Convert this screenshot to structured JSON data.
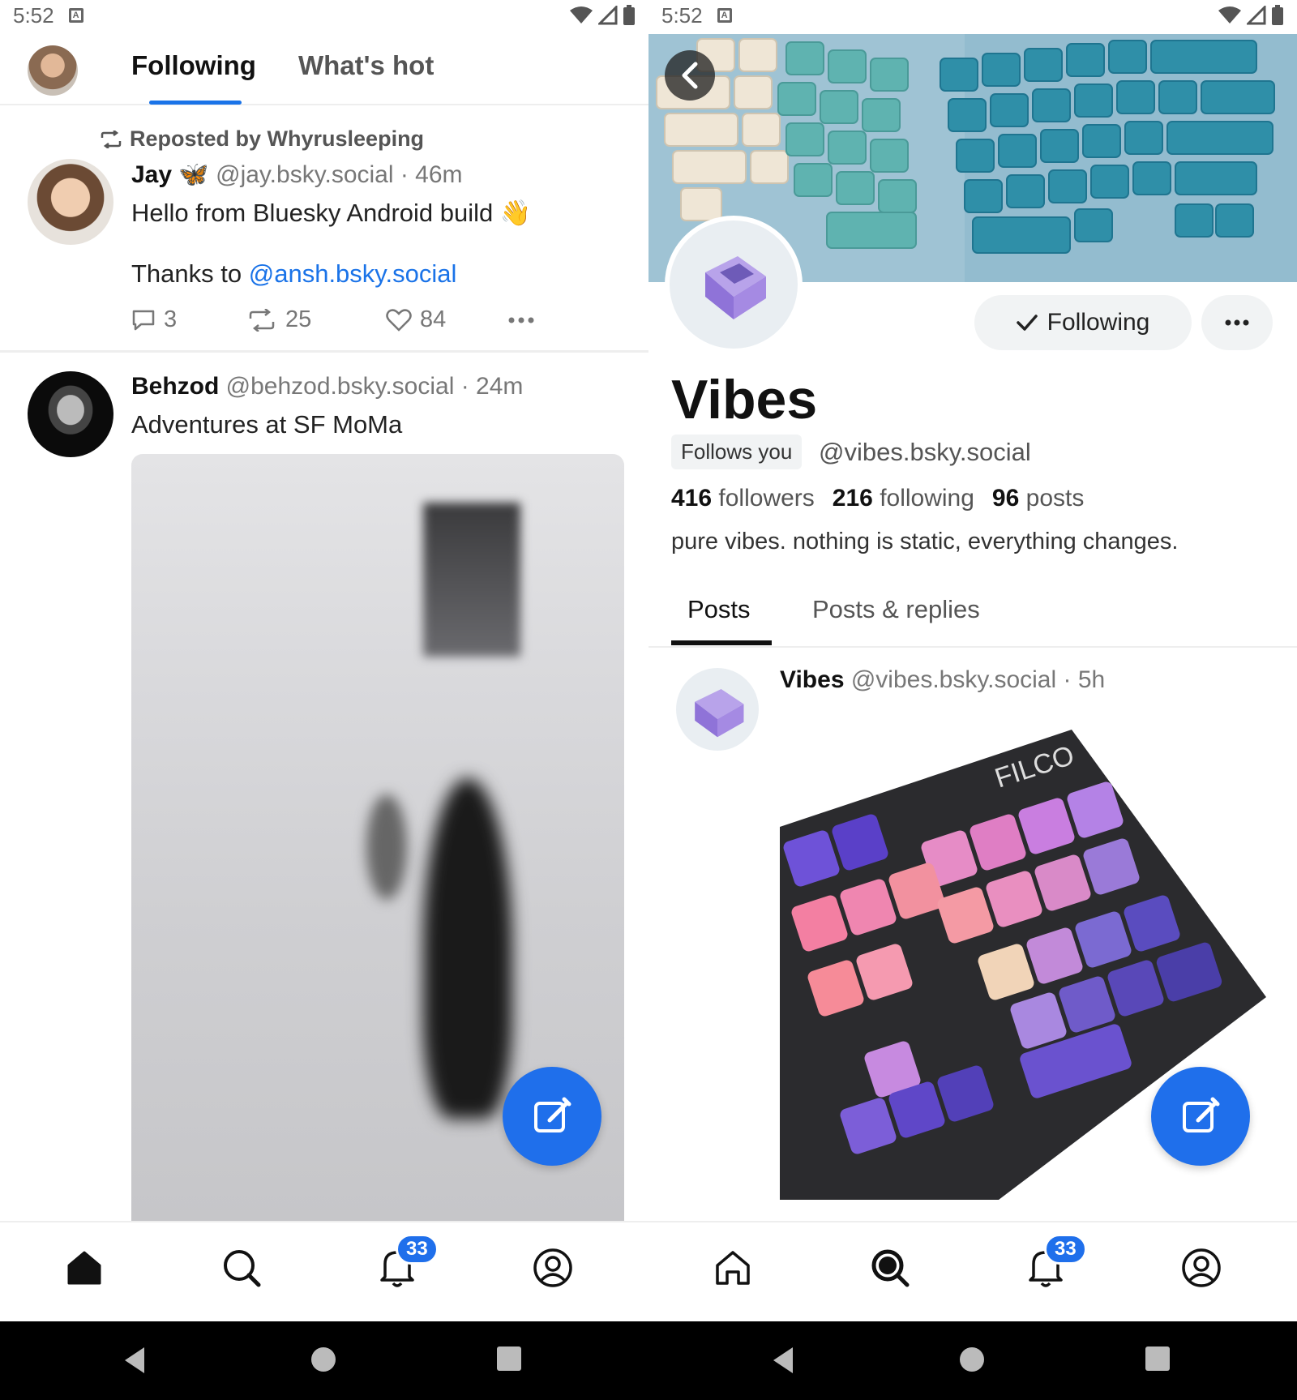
{
  "left": {
    "status": {
      "time": "5:52"
    },
    "tabs": [
      "Following",
      "What's hot"
    ],
    "feed": [
      {
        "repost_label": "Reposted by Whyrusleeping",
        "name": "Jay",
        "emoji": "🦋",
        "handle": "@jay.bsky.social",
        "time": "· 46m",
        "text_line1": "Hello from Bluesky Android build",
        "text_emoji": "👋",
        "text_line2_prefix": "Thanks to ",
        "text_mention": "@ansh.bsky.social",
        "replies": "3",
        "reposts": "25",
        "likes": "84"
      },
      {
        "name": "Behzod",
        "handle": "@behzod.bsky.social",
        "time": "· 24m",
        "text": "Adventures at SF MoMa"
      }
    ],
    "nav": {
      "notifications_badge": "33"
    }
  },
  "right": {
    "status": {
      "time": "5:52"
    },
    "profile": {
      "display_name": "Vibes",
      "follows_you": "Follows you",
      "handle": "@vibes.bsky.social",
      "followers_count": "416",
      "followers_label": "followers",
      "following_count": "216",
      "following_label": "following",
      "posts_count": "96",
      "posts_label": "posts",
      "bio": "pure vibes. nothing is static, everything changes.",
      "following_button": "Following"
    },
    "tabs": [
      "Posts",
      "Posts & replies"
    ],
    "post": {
      "name": "Vibes",
      "handle": "@vibes.bsky.social",
      "time": "· 5h",
      "image_text": "FILCO"
    },
    "nav": {
      "notifications_badge": "33"
    }
  },
  "colors": {
    "accent": "#1f6feb",
    "link": "#1a73e8"
  },
  "icons": [
    "repost-icon",
    "reply-icon",
    "like-icon",
    "more-icon",
    "compose-icon",
    "home-icon",
    "search-icon",
    "bell-icon",
    "profile-icon",
    "back-icon",
    "checkmark-icon",
    "wifi-icon",
    "signal-icon",
    "battery-icon"
  ]
}
